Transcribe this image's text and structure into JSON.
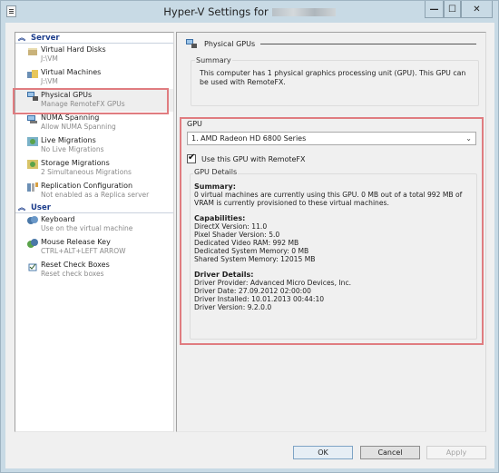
{
  "window": {
    "title": "Hyper-V Settings for",
    "controls": {
      "minimize": "—",
      "maximize": "☐",
      "close": "✕"
    }
  },
  "sidebar": {
    "sections": [
      {
        "label": "Server",
        "items": [
          {
            "name": "Virtual Hard Disks",
            "sub": "J:\\VM",
            "icon": "hard-disk-icon"
          },
          {
            "name": "Virtual Machines",
            "sub": "J:\\VM",
            "icon": "folder-icon"
          },
          {
            "name": "Physical GPUs",
            "sub": "Manage RemoteFX GPUs",
            "icon": "gpu-icon",
            "selected": true
          },
          {
            "name": "NUMA Spanning",
            "sub": "Allow NUMA Spanning",
            "icon": "numa-icon"
          },
          {
            "name": "Live Migrations",
            "sub": "No Live Migrations",
            "icon": "live-migration-icon"
          },
          {
            "name": "Storage Migrations",
            "sub": "2 Simultaneous Migrations",
            "icon": "storage-migration-icon"
          },
          {
            "name": "Replication Configuration",
            "sub": "Not enabled as a Replica server",
            "icon": "replication-icon"
          }
        ]
      },
      {
        "label": "User",
        "items": [
          {
            "name": "Keyboard",
            "sub": "Use on the virtual machine",
            "icon": "keyboard-icon"
          },
          {
            "name": "Mouse Release Key",
            "sub": "CTRL+ALT+LEFT ARROW",
            "icon": "mouse-icon"
          },
          {
            "name": "Reset Check Boxes",
            "sub": "Reset check boxes",
            "icon": "reset-checkbox-icon"
          }
        ]
      }
    ]
  },
  "panel": {
    "title": "Physical GPUs",
    "summary_label": "Summary",
    "summary_text": "This computer has 1 physical graphics processing unit (GPU). This GPU can be used with RemoteFX.",
    "gpu_label": "GPU",
    "gpu_selected": "1. AMD Radeon HD 6800 Series",
    "use_remotefx_label": "Use this GPU with RemoteFX",
    "use_remotefx_checked": true,
    "details_label": "GPU Details",
    "details": {
      "summary_heading": "Summary:",
      "summary_lines": [
        "0 virtual machines are currently using this GPU. 0 MB out of a total 992 MB of",
        "VRAM is currently provisioned to these virtual machines."
      ],
      "capabilities_heading": "Capabilities:",
      "capabilities": [
        "DirectX Version: 11.0",
        "Pixel Shader Version: 5.0",
        "Dedicated Video RAM: 992 MB",
        "Dedicated System Memory: 0 MB",
        "Shared System Memory: 12015 MB"
      ],
      "driver_heading": "Driver Details:",
      "driver": [
        "Driver Provider: Advanced Micro Devices, Inc.",
        "Driver Date: 27.09.2012 02:00:00",
        "Driver Installed: 10.01.2013 00:44:10",
        "Driver Version: 9.2.0.0"
      ]
    }
  },
  "buttons": {
    "ok": "OK",
    "cancel": "Cancel",
    "apply": "Apply"
  },
  "colors": {
    "highlight": "#e07c80",
    "section_header": "#1c3d8c",
    "window_frame": "#c8dae5"
  }
}
